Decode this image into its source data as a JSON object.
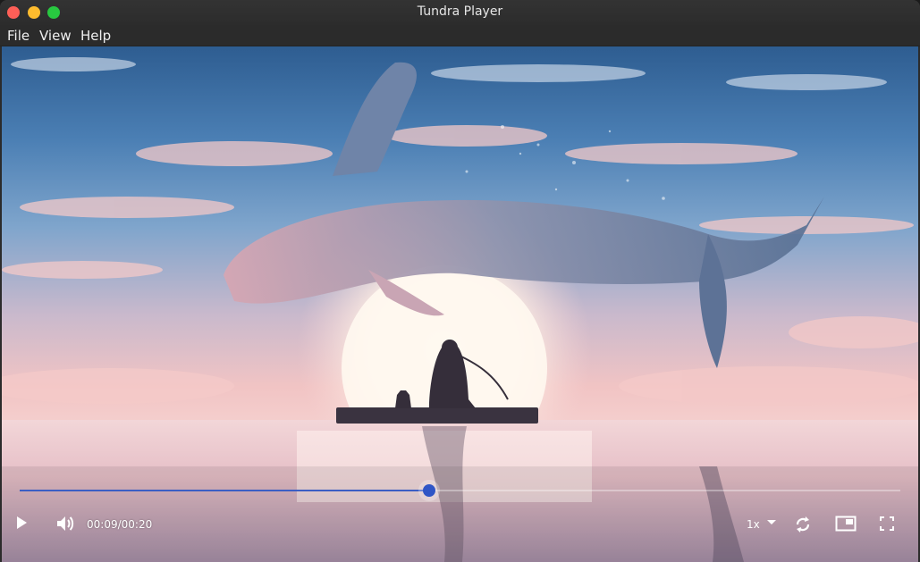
{
  "window": {
    "title": "Tundra Player"
  },
  "menubar": {
    "items": [
      "File",
      "View",
      "Help"
    ]
  },
  "player": {
    "time_display": "00:09/00:20",
    "current_time": "00:09",
    "duration": "00:20",
    "progress": 0.465,
    "speed_label": "1x"
  },
  "icons": {
    "play": "play-icon",
    "volume": "volume-icon",
    "speed_dropdown": "chevron-down-icon",
    "loop": "loop-icon",
    "pip": "picture-in-picture-icon",
    "fullscreen": "fullscreen-icon"
  },
  "colors": {
    "accent": "#2f56c6",
    "titlebar": "#2c2c2c"
  }
}
